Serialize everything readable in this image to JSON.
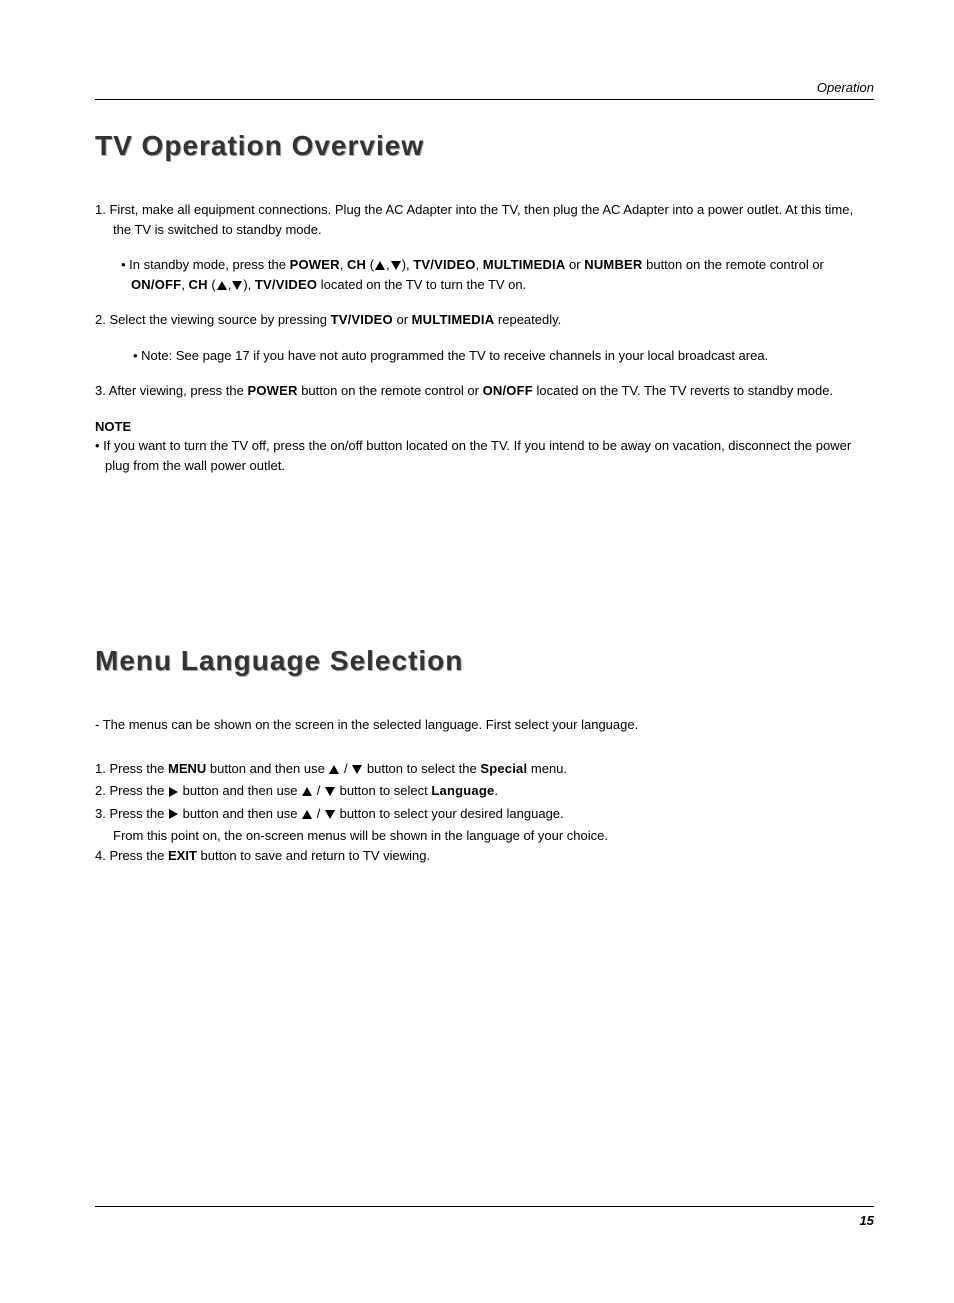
{
  "header": {
    "section_label": "Operation"
  },
  "section1": {
    "title": "TV Operation Overview",
    "item1_a": "1. First, make all equipment connections. Plug the AC Adapter into the TV, then plug the AC Adapter into a power outlet. At this time, the TV is switched to standby mode.",
    "item1_sub_prefix": "• In standby mode, press the ",
    "kw_power": "POWER",
    "kw_ch": "CH",
    "kw_tvvideo": "TV/VIDEO",
    "kw_multimedia": "MULTIMEDIA",
    "kw_number": "NUMBER",
    "kw_onoff": "ON/OFF",
    "item1_sub_mid1": " button on the remote control or ",
    "item1_sub_end": " located on the TV to turn the TV on.",
    "txt_comma_space": ", ",
    "txt_or": " or ",
    "txt_paren_open": " (",
    "txt_paren_close": "), ",
    "txt_comma": ",",
    "item2_a": "2. Select the viewing source by pressing ",
    "item2_b": " repeatedly.",
    "item2_note": "• Note: See page 17 if you have not auto programmed the TV to receive channels in your local broadcast area.",
    "item3_a": "3. After viewing, press the ",
    "item3_b": " button on the remote control or ",
    "item3_c": " located on the TV. The TV reverts to standby mode.",
    "note_heading": "NOTE",
    "note_body": "• If you want to turn the TV off, press the on/off button located on the TV. If you intend to be away on vacation, disconnect the power plug from the wall power outlet."
  },
  "section2": {
    "title": "Menu Language Selection",
    "intro_dash": "- ",
    "intro": "The menus can be shown on the screen in the selected language. First select your language.",
    "item1_a": "1. Press the ",
    "kw_menu": "MENU",
    "item1_b": " button and then use ",
    "item1_c": " button to select the ",
    "kw_special": "Special",
    "item1_d": " menu.",
    "item2_a": "2. Press the ",
    "item2_b": " button and then use ",
    "item2_c": " button to select ",
    "kw_language": "Language",
    "txt_period": ".",
    "item3_a": "3. Press the ",
    "item3_b": " button and then use ",
    "item3_c": " button to select your desired language.",
    "item3_d": "From this point on, the on-screen menus will be shown in the language of your choice.",
    "item4_a": "4. Press the ",
    "kw_exit": "EXIT",
    "item4_b": " button to save and return to TV viewing.",
    "txt_slash": " / "
  },
  "footer": {
    "page_number": "15"
  }
}
